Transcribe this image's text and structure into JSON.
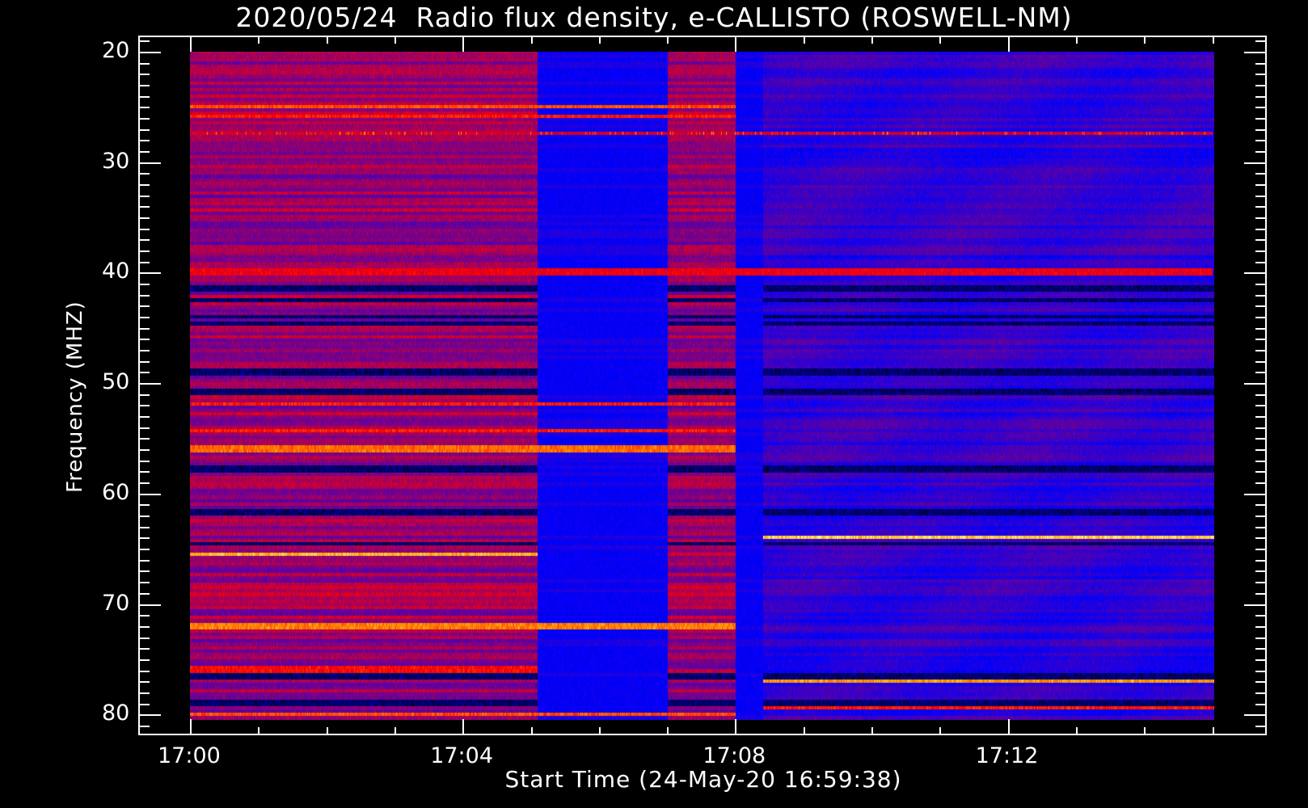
{
  "chart_data": {
    "type": "heatmap",
    "title": "2020/05/24  Radio flux density, e-CALLISTO (ROSWELL-NM)",
    "xlabel": "Start Time (24-May-20 16:59:38)",
    "ylabel": "Frequency (MHZ)",
    "x_ticks": [
      "17:00",
      "17:04",
      "17:08",
      "17:12"
    ],
    "x_tick_minutes": [
      0,
      4,
      8,
      12
    ],
    "xlim_minutes_after_1700": [
      0,
      15.05
    ],
    "y_ticks": [
      "20",
      "30",
      "40",
      "50",
      "60",
      "70",
      "80"
    ],
    "y_tick_values": [
      20,
      30,
      40,
      50,
      60,
      70,
      80
    ],
    "ylim": [
      20,
      80.5
    ],
    "y_inverted": true,
    "colormap": [
      "#000000",
      "#0000ff",
      "#800080",
      "#ff0000",
      "#ffa000",
      "#ffff96"
    ],
    "segments": [
      {
        "start_min": 0.0,
        "end_min": 5.1,
        "level": "high"
      },
      {
        "start_min": 5.1,
        "end_min": 7.0,
        "level": "low"
      },
      {
        "start_min": 7.0,
        "end_min": 8.0,
        "level": "high"
      },
      {
        "start_min": 8.0,
        "end_min": 8.4,
        "level": "low"
      },
      {
        "start_min": 8.4,
        "end_min": 15.05,
        "level": "medium"
      }
    ],
    "bright_bands_mhz": [
      {
        "freq": 25.0,
        "start_min": 0.0,
        "end_min": 8.0,
        "intensity": 0.85
      },
      {
        "freq": 26.0,
        "start_min": 0.0,
        "end_min": 8.0,
        "intensity": 0.8
      },
      {
        "freq": 27.4,
        "start_min": 0.0,
        "end_min": 15.0,
        "intensity": 0.8
      },
      {
        "freq": 40.0,
        "start_min": 0.0,
        "end_min": 15.0,
        "intensity": 0.75
      },
      {
        "freq": 52.0,
        "start_min": 0.0,
        "end_min": 8.0,
        "intensity": 0.8
      },
      {
        "freq": 54.4,
        "start_min": 0.0,
        "end_min": 8.0,
        "intensity": 0.8
      },
      {
        "freq": 56.0,
        "start_min": 0.0,
        "end_min": 8.0,
        "intensity": 0.88
      },
      {
        "freq": 64.0,
        "start_min": 8.4,
        "end_min": 15.05,
        "intensity": 0.98
      },
      {
        "freq": 65.5,
        "start_min": 0.0,
        "end_min": 5.1,
        "intensity": 0.95
      },
      {
        "freq": 72.0,
        "start_min": 0.0,
        "end_min": 8.0,
        "intensity": 0.9
      },
      {
        "freq": 76.0,
        "start_min": 0.0,
        "end_min": 5.1,
        "intensity": 0.78
      },
      {
        "freq": 77.0,
        "start_min": 8.4,
        "end_min": 15.05,
        "intensity": 0.92
      },
      {
        "freq": 79.4,
        "start_min": 8.4,
        "end_min": 15.05,
        "intensity": 0.8
      },
      {
        "freq": 80.0,
        "start_min": 0.0,
        "end_min": 8.0,
        "intensity": 0.85
      }
    ],
    "dark_bands_mhz": [
      41.5,
      42.5,
      44.0,
      44.6,
      49.0,
      50.8,
      57.8,
      61.8,
      64.6,
      76.5,
      79.0
    ]
  }
}
